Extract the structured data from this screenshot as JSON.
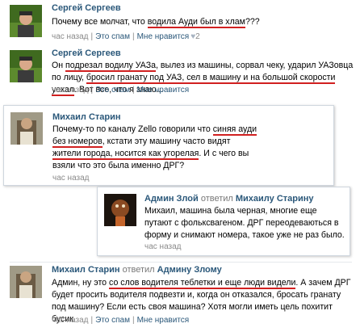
{
  "c1": {
    "author": "Сергей Сергеев",
    "t1": "Почему все молчат, что ",
    "u1": "водила Ауди был в хлам",
    "t2": "???",
    "time": "час назад",
    "spam": "Это спам",
    "like": "Мне нравится",
    "likes": "2"
  },
  "c2": {
    "author": "Сергей Сергеев",
    "t1": "Он ",
    "u1": "подрезал водилу УАЗа",
    "t2": ", вылез из машины, сорвал чеку, ударил УАЗовца по лицу, ",
    "u2": "бросил гранату под УАЗ, сел в машину и на большой скорости уехал",
    "t3": ". Вот все, что я знаю...",
    "time": "час назад",
    "spam": "Это спам",
    "like": "Мне нравится"
  },
  "c3": {
    "author": "Михаил Старин",
    "t1": "Почему-то по каналу Zello говорили что ",
    "u1": "синяя ауди без номеров",
    "t2": ", кстати эту машину часто видят ",
    "u2": "жители города, носится как угорелая",
    "t3": ". И с чего вы взяли что это была именно ДРГ?",
    "time": "час назад"
  },
  "c4": {
    "author": "Админ Злой",
    "replied": "ответил",
    "target": "Михаилу Старину",
    "text": "Михаил, машина была черная, многие еще путают с фольксвагеном. ДРГ переодеваються в форму и снимают номера, такое уже не раз было.",
    "time": "час назад"
  },
  "c5": {
    "author": "Михаил Старин",
    "replied": "ответил",
    "target": "Админу Злому",
    "t1": "Админ, ну это ",
    "u1": "со слов водителя теблетки и еще люди видели",
    "t2": ". А зачем ДРГ будет просить водителя подвезти и, когда он отказался, бросать гранату под машину? Если есть своя машина? Хотя могли иметь цель похитит бусик.",
    "time": "час назад",
    "spam": "Это спам",
    "like": "Мне нравится"
  },
  "sep": "|",
  "heart_icon": "heart-icon",
  "underline_color": "#d12020"
}
